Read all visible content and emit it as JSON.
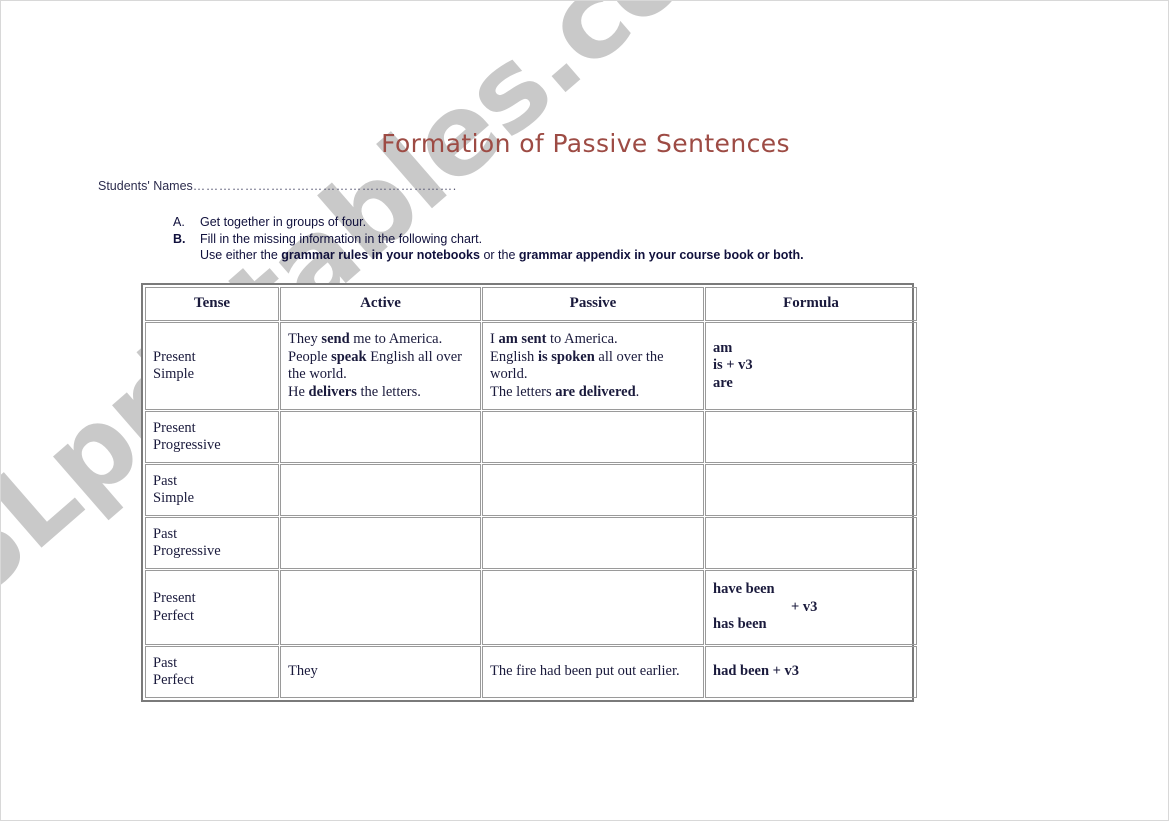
{
  "document": {
    "title": "Formation of Passive Sentences",
    "students_label": "Students' Names",
    "students_dots": "……………………………………………………."
  },
  "instructions": [
    {
      "marker": "A.",
      "marker_bold": false,
      "text": "Get together in groups of four.",
      "sub": null
    },
    {
      "marker": "B.",
      "marker_bold": true,
      "text": "Fill in the missing information in the following chart.",
      "sub_parts": [
        {
          "text": "Use either the ",
          "bold": false
        },
        {
          "text": "grammar rules in your notebooks",
          "bold": true
        },
        {
          "text": " or the ",
          "bold": false
        },
        {
          "text": "grammar appendix in your course book or both.",
          "bold": true
        }
      ]
    }
  ],
  "chart": {
    "headers": [
      "Tense",
      "Active",
      "Passive",
      "Formula"
    ],
    "rows": [
      {
        "tense": "Present\nSimple",
        "active_parts": [
          {
            "text": "They ",
            "bold": false
          },
          {
            "text": "send",
            "bold": true
          },
          {
            "text": " me to America.",
            "bold": false
          },
          {
            "text": "\n",
            "bold": false
          },
          {
            "text": "People ",
            "bold": false
          },
          {
            "text": "speak",
            "bold": true
          },
          {
            "text": " English all over the world.",
            "bold": false
          },
          {
            "text": "\n",
            "bold": false
          },
          {
            "text": "He ",
            "bold": false
          },
          {
            "text": "delivers",
            "bold": true
          },
          {
            "text": " the letters.",
            "bold": false
          }
        ],
        "passive_parts": [
          {
            "text": "I ",
            "bold": false
          },
          {
            "text": "am sent",
            "bold": true
          },
          {
            "text": " to America.",
            "bold": false
          },
          {
            "text": "\n",
            "bold": false
          },
          {
            "text": "English ",
            "bold": false
          },
          {
            "text": "is spoken",
            "bold": true
          },
          {
            "text": " all over the world.",
            "bold": false
          },
          {
            "text": "\n",
            "bold": false
          },
          {
            "text": "The letters ",
            "bold": false
          },
          {
            "text": "are delivered",
            "bold": true
          },
          {
            "text": ".",
            "bold": false
          }
        ],
        "formula": "am\nis + v3\nare",
        "formula_indent_v3": false
      },
      {
        "tense": "Present\nProgressive",
        "active_parts": [],
        "passive_parts": [],
        "formula": "",
        "formula_indent_v3": false
      },
      {
        "tense": "Past\nSimple",
        "active_parts": [],
        "passive_parts": [],
        "formula": "",
        "formula_indent_v3": false
      },
      {
        "tense": "Past\nProgressive",
        "active_parts": [],
        "passive_parts": [],
        "formula": "",
        "formula_indent_v3": false
      },
      {
        "tense": "Present\nPerfect",
        "active_parts": [],
        "passive_parts": [],
        "formula_lines": [
          "have been",
          "+ v3",
          "has been"
        ],
        "formula_indent_v3": true
      },
      {
        "tense": "Past\nPerfect",
        "active_parts": [
          {
            "text": "They",
            "bold": false
          }
        ],
        "passive_parts": [
          {
            "text": "The fire had been put out earlier.",
            "bold": false
          }
        ],
        "formula": "had been + v3",
        "formula_indent_v3": false
      }
    ]
  },
  "watermark": {
    "text": "ESLprintables.com"
  },
  "colors": {
    "title": "#9d4b44",
    "text": "#10103c",
    "table_text": "#1a1a3c",
    "border": "#9a9a9a",
    "frame": "#7a7a7a",
    "watermark": "#c9c9c9"
  }
}
